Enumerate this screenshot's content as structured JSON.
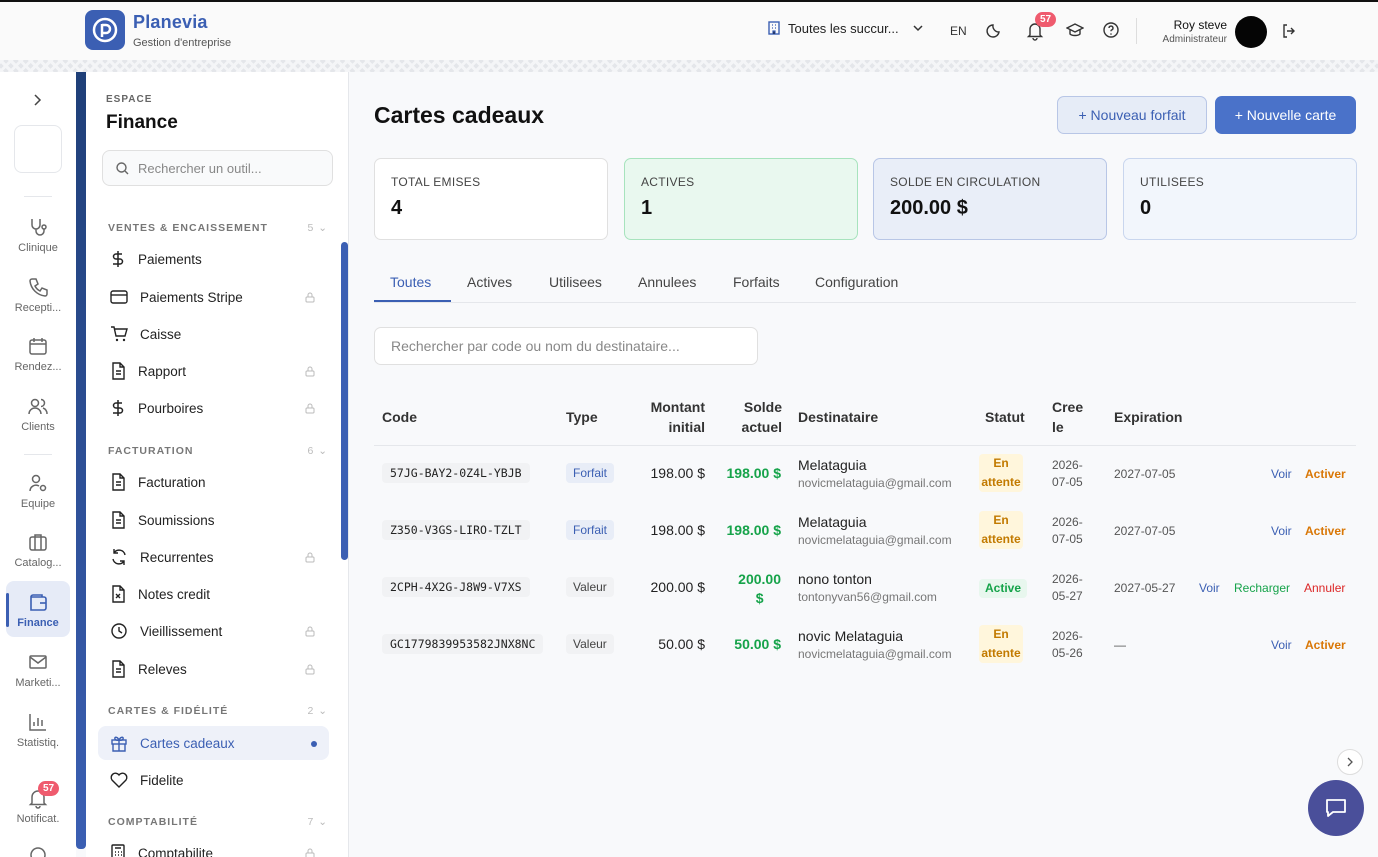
{
  "brand": {
    "name": "Planevia",
    "subtitle": "Gestion d'entreprise"
  },
  "topbar": {
    "branch": "Toutes les succur...",
    "lang": "EN",
    "notif_count": "57",
    "user_name": "Roy steve",
    "user_role": "Administrateur"
  },
  "rail": {
    "items": [
      {
        "label": "Clinique",
        "icon": "stethoscope-icon"
      },
      {
        "label": "Recepti...",
        "icon": "phone-icon"
      },
      {
        "label": "Rendez...",
        "icon": "calendar-icon"
      },
      {
        "label": "Clients",
        "icon": "users-icon"
      },
      {
        "label": "Equipe",
        "icon": "user-cog-icon"
      },
      {
        "label": "Catalog...",
        "icon": "briefcase-icon"
      },
      {
        "label": "Finance",
        "icon": "wallet-icon"
      },
      {
        "label": "Marketi...",
        "icon": "mail-icon"
      },
      {
        "label": "Statistiq.",
        "icon": "bar-chart-icon"
      },
      {
        "label": "Notificat.",
        "icon": "bell-icon"
      }
    ],
    "notif_badge": "57"
  },
  "sidebar": {
    "eyebrow": "ESPACE",
    "title": "Finance",
    "search_placeholder": "Rechercher un outil...",
    "sections": [
      {
        "label": "VENTES & ENCAISSEMENT",
        "count": "5"
      },
      {
        "label": "FACTURATION",
        "count": "6"
      },
      {
        "label": "CARTES & FIDÉLITÉ",
        "count": "2"
      },
      {
        "label": "COMPTABILITÉ",
        "count": "7"
      }
    ],
    "items": [
      {
        "label": "Paiements",
        "icon": "dollar-icon"
      },
      {
        "label": "Paiements Stripe",
        "icon": "credit-card-icon"
      },
      {
        "label": "Caisse",
        "icon": "cart-icon"
      },
      {
        "label": "Rapport",
        "icon": "file-icon"
      },
      {
        "label": "Pourboires",
        "icon": "dollar-icon"
      },
      {
        "label": "Facturation",
        "icon": "file-icon"
      },
      {
        "label": "Soumissions",
        "icon": "file-icon"
      },
      {
        "label": "Recurrentes",
        "icon": "refresh-icon"
      },
      {
        "label": "Notes credit",
        "icon": "file-x-icon"
      },
      {
        "label": "Vieillissement",
        "icon": "clock-icon"
      },
      {
        "label": "Releves",
        "icon": "file-icon"
      },
      {
        "label": "Cartes cadeaux",
        "icon": "gift-icon"
      },
      {
        "label": "Fidelite",
        "icon": "heart-icon"
      },
      {
        "label": "Comptabilite",
        "icon": "calculator-icon"
      }
    ]
  },
  "page": {
    "title": "Cartes cadeaux",
    "btn_forfait": "+ Nouveau forfait",
    "btn_carte": "+ Nouvelle carte",
    "stats": [
      {
        "label": "TOTAL EMISES",
        "value": "4"
      },
      {
        "label": "ACTIVES",
        "value": "1"
      },
      {
        "label": "SOLDE EN CIRCULATION",
        "value": "200.00 $"
      },
      {
        "label": "UTILISEES",
        "value": "0"
      }
    ],
    "tabs": [
      "Toutes",
      "Actives",
      "Utilisees",
      "Annulees",
      "Forfaits",
      "Configuration"
    ],
    "search_placeholder": "Rechercher par code ou nom du destinataire...",
    "table": {
      "headers": {
        "code": "Code",
        "type": "Type",
        "mi1": "Montant",
        "mi2": "initial",
        "sa1": "Solde",
        "sa2": "actuel",
        "dest": "Destinataire",
        "statut": "Statut",
        "cree1": "Cree",
        "cree2": "le",
        "exp": "Expiration"
      },
      "rows": [
        {
          "code": "57JG-BAY2-0Z4L-YBJB",
          "type": "Forfait",
          "initial": "198.00 $",
          "solde": "198.00 $",
          "name": "Melataguia",
          "email": "novicmelataguia@gmail.com",
          "status1": "En",
          "status2": "attente",
          "cree1": "2026-",
          "cree2": "07-05",
          "exp": "2027-07-05",
          "act_voir": "Voir",
          "act_main": "Activer"
        },
        {
          "code": "Z350-V3GS-LIRO-TZLT",
          "type": "Forfait",
          "initial": "198.00 $",
          "solde": "198.00 $",
          "name": "Melataguia",
          "email": "novicmelataguia@gmail.com",
          "status1": "En",
          "status2": "attente",
          "cree1": "2026-",
          "cree2": "07-05",
          "exp": "2027-07-05",
          "act_voir": "Voir",
          "act_main": "Activer"
        },
        {
          "code": "2CPH-4X2G-J8W9-V7XS",
          "type": "Valeur",
          "initial": "200.00 $",
          "solde1": "200.00",
          "solde2": "$",
          "name": "nono tonton",
          "email": "tontonyvan56@gmail.com",
          "status": "Active",
          "cree1": "2026-",
          "cree2": "05-27",
          "exp": "2027-05-27",
          "act_voir": "Voir",
          "act_rech": "Recharger",
          "act_ann": "Annuler"
        },
        {
          "code": "GC1779839953582JNX8NC",
          "type": "Valeur",
          "initial": "50.00 $",
          "solde": "50.00 $",
          "name": "novic Melataguia",
          "email": "novicmelataguia@gmail.com",
          "status1": "En",
          "status2": "attente",
          "cree1": "2026-",
          "cree2": "05-26",
          "exp": "—",
          "act_voir": "Voir",
          "act_main": "Activer"
        }
      ]
    }
  }
}
